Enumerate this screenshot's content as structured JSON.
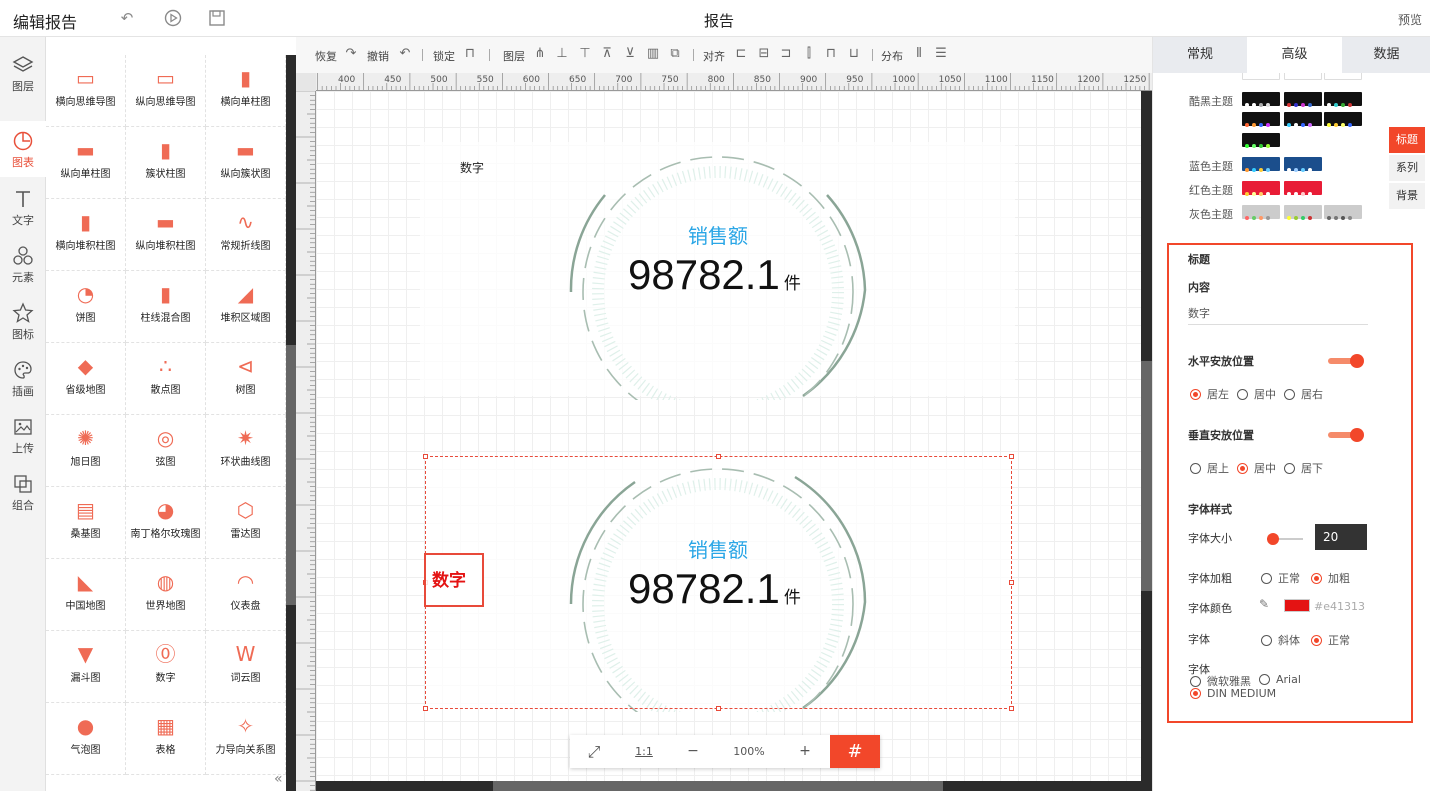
{
  "app": {
    "title": "编辑报告",
    "report_title": "报告",
    "preview": "预览"
  },
  "leftnav": [
    {
      "label": "图层",
      "icon": "layers-icon"
    },
    {
      "label": "图表",
      "icon": "chart-pie-icon"
    },
    {
      "label": "文字",
      "icon": "text-icon"
    },
    {
      "label": "元素",
      "icon": "shapes-icon"
    },
    {
      "label": "图标",
      "icon": "star-icon"
    },
    {
      "label": "插画",
      "icon": "palette-icon"
    },
    {
      "label": "上传",
      "icon": "upload-image-icon"
    },
    {
      "label": "组合",
      "icon": "group-icon"
    }
  ],
  "palette": [
    "横向思维导图",
    "纵向思维导图",
    "横向单柱图",
    "纵向单柱图",
    "簇状柱图",
    "纵向簇状图",
    "横向堆积柱图",
    "纵向堆积柱图",
    "常规折线图",
    "饼图",
    "柱线混合图",
    "堆积区域图",
    "省级地图",
    "散点图",
    "树图",
    "旭日图",
    "弦图",
    "环状曲线图",
    "桑基图",
    "南丁格尔玫瑰图",
    "雷达图",
    "中国地图",
    "世界地图",
    "仪表盘",
    "漏斗图",
    "数字",
    "词云图",
    "气泡图",
    "表格",
    "力导向关系图"
  ],
  "toolbar": {
    "redo": "恢复",
    "undo": "撤销",
    "lock": "锁定",
    "layer": "图层",
    "align": "对齐",
    "distribute": "分布"
  },
  "ruler": {
    "h": [
      "400",
      "450",
      "500",
      "550",
      "600",
      "650",
      "700",
      "750",
      "800",
      "850",
      "900",
      "950",
      "1000",
      "1050",
      "1100",
      "1150",
      "1200",
      "1250"
    ]
  },
  "widgets": [
    {
      "title": "数字",
      "label": "销售额",
      "value": "98782.1",
      "unit": "件"
    },
    {
      "title": "数字",
      "label": "销售额",
      "value": "98782.1",
      "unit": "件"
    }
  ],
  "zoom": {
    "fit": "⤢",
    "one": "1:1",
    "minus": "−",
    "level": "100%",
    "plus": "+"
  },
  "rightpanel": {
    "tabs": [
      "常规",
      "高级",
      "数据"
    ],
    "themes": {
      "dark": "酷黑主题",
      "blue": "蓝色主题",
      "red": "红色主题",
      "gray": "灰色主题"
    },
    "sidetabs": [
      "标题",
      "系列",
      "背景"
    ]
  },
  "props": {
    "section": "标题",
    "content_label": "内容",
    "content_value": "数字",
    "h_pos_label": "水平安放位置",
    "h_pos": [
      "居左",
      "居中",
      "居右"
    ],
    "v_pos_label": "垂直安放位置",
    "v_pos": [
      "居上",
      "居中",
      "居下"
    ],
    "font_style_label": "字体样式",
    "font_size_label": "字体大小",
    "font_size": "20",
    "font_weight_label": "字体加粗",
    "font_weight": [
      "正常",
      "加粗"
    ],
    "font_color_label": "字体颜色",
    "font_color": "#e41313",
    "font_italic_label": "字体",
    "font_italic": [
      "斜体",
      "正常"
    ],
    "font_family_label": "字体",
    "font_family": [
      "微软雅黑",
      "Arial",
      "DIN MEDIUM"
    ]
  },
  "colors": {
    "accent": "#f2472a",
    "title_red": "#e41313",
    "label_blue": "#2aa6e6"
  }
}
